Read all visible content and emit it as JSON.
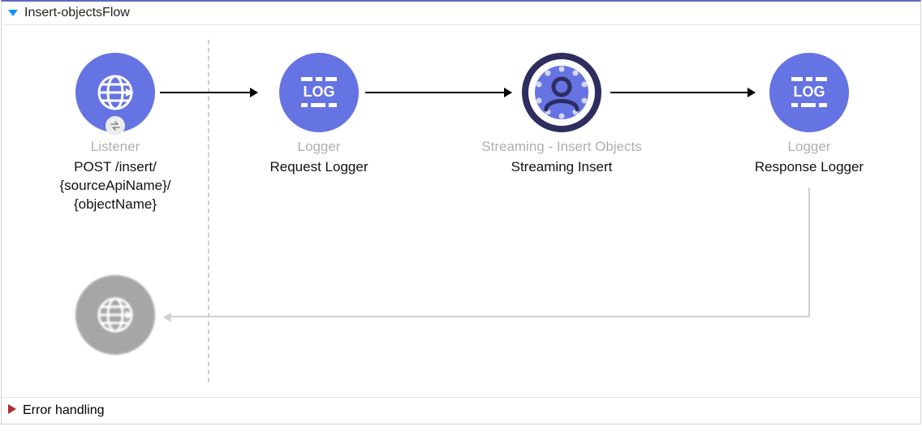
{
  "sections": {
    "flow": {
      "title": "Insert-objectsFlow",
      "expanded": true
    },
    "error": {
      "title": "Error handling",
      "expanded": false
    }
  },
  "nodes": {
    "listener": {
      "type": "Listener",
      "name": "POST /insert/\n{sourceApiName}/\n{objectName}",
      "icon": "globe-arrow",
      "color": "blue"
    },
    "reqLogger": {
      "type": "Logger",
      "name": "Request Logger",
      "icon": "log",
      "color": "blue"
    },
    "streaming": {
      "type": "Streaming - Insert Objects",
      "name": "Streaming Insert",
      "icon": "person-ring",
      "color": "ring"
    },
    "respLogger": {
      "type": "Logger",
      "name": "Response Logger",
      "icon": "log",
      "color": "blue"
    },
    "returnNode": {
      "type": "",
      "name": "",
      "icon": "globe-arrow",
      "color": "grey"
    }
  },
  "colors": {
    "accent": "#6573e3",
    "ringDark": "#2d2d60",
    "grey": "#a6a6a6",
    "expandBlue": "#178fff",
    "collapseRed": "#b02a2a"
  }
}
